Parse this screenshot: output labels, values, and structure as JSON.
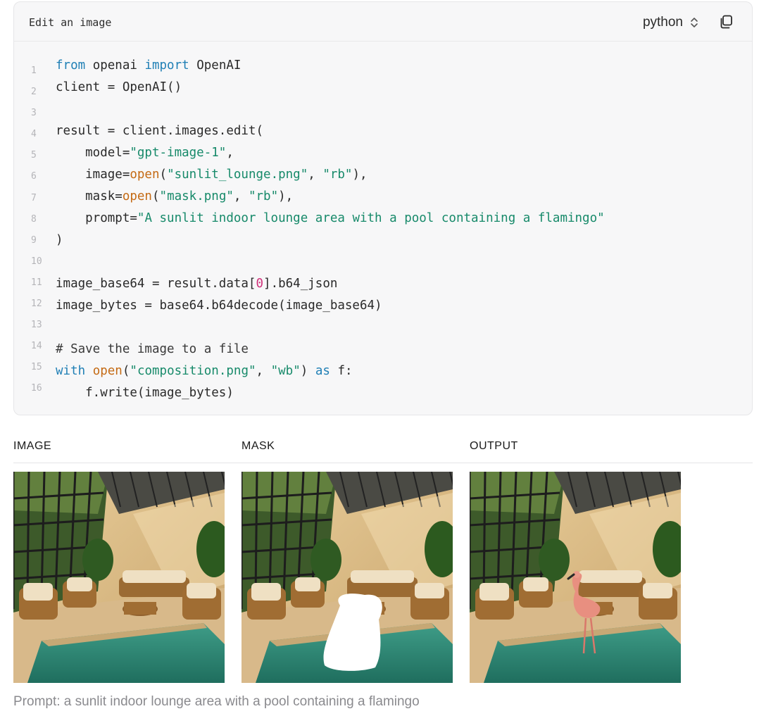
{
  "code_block": {
    "title": "Edit an image",
    "language": "python",
    "line_numbers": [
      "1",
      "2",
      "3",
      "4",
      "5",
      "6",
      "7",
      "8",
      "9",
      "10",
      "11",
      "12",
      "13",
      "14",
      "15",
      "16"
    ],
    "lines": [
      [
        {
          "t": "kw",
          "v": "from"
        },
        {
          "t": "p",
          "v": " openai "
        },
        {
          "t": "kw",
          "v": "import"
        },
        {
          "t": "p",
          "v": " OpenAI"
        }
      ],
      [
        {
          "t": "p",
          "v": "client = OpenAI()"
        }
      ],
      [],
      [
        {
          "t": "p",
          "v": "result = client.images.edit("
        }
      ],
      [
        {
          "t": "p",
          "v": "    model="
        },
        {
          "t": "str",
          "v": "\"gpt-image-1\""
        },
        {
          "t": "p",
          "v": ","
        }
      ],
      [
        {
          "t": "p",
          "v": "    image="
        },
        {
          "t": "fn",
          "v": "open"
        },
        {
          "t": "p",
          "v": "("
        },
        {
          "t": "str",
          "v": "\"sunlit_lounge.png\""
        },
        {
          "t": "p",
          "v": ", "
        },
        {
          "t": "str",
          "v": "\"rb\""
        },
        {
          "t": "p",
          "v": "),"
        }
      ],
      [
        {
          "t": "p",
          "v": "    mask="
        },
        {
          "t": "fn",
          "v": "open"
        },
        {
          "t": "p",
          "v": "("
        },
        {
          "t": "str",
          "v": "\"mask.png\""
        },
        {
          "t": "p",
          "v": ", "
        },
        {
          "t": "str",
          "v": "\"rb\""
        },
        {
          "t": "p",
          "v": "),"
        }
      ],
      [
        {
          "t": "p",
          "v": "    prompt="
        },
        {
          "t": "str",
          "v": "\"A sunlit indoor lounge area with a pool containing a flamingo\""
        }
      ],
      [
        {
          "t": "p",
          "v": ")"
        }
      ],
      [],
      [
        {
          "t": "p",
          "v": "image_base64 = result.data["
        },
        {
          "t": "num",
          "v": "0"
        },
        {
          "t": "p",
          "v": "].b64_json"
        }
      ],
      [
        {
          "t": "p",
          "v": "image_bytes = base64.b64decode(image_base64)"
        }
      ],
      [],
      [
        {
          "t": "cm",
          "v": "# Save the image to a file"
        }
      ],
      [
        {
          "t": "kw",
          "v": "with"
        },
        {
          "t": "p",
          "v": " "
        },
        {
          "t": "fn",
          "v": "open"
        },
        {
          "t": "p",
          "v": "("
        },
        {
          "t": "str",
          "v": "\"composition.png\""
        },
        {
          "t": "p",
          "v": ", "
        },
        {
          "t": "str",
          "v": "\"wb\""
        },
        {
          "t": "p",
          "v": ") "
        },
        {
          "t": "kw",
          "v": "as"
        },
        {
          "t": "p",
          "v": " f:"
        }
      ],
      [
        {
          "t": "p",
          "v": "    f.write(image_bytes)"
        }
      ]
    ],
    "icons": {
      "language": "chevron-up-down-icon",
      "copy": "copy-icon"
    }
  },
  "gallery": {
    "columns": [
      {
        "label": "IMAGE",
        "variant": "original"
      },
      {
        "label": "MASK",
        "variant": "mask"
      },
      {
        "label": "OUTPUT",
        "variant": "output"
      }
    ],
    "caption": "Prompt: a sunlit indoor lounge area with a pool containing a flamingo"
  },
  "colors": {
    "keyword": "#1f7fb5",
    "string": "#178a6a",
    "builtin": "#c46a14",
    "number": "#d0317a",
    "code_bg": "#f7f7f8",
    "caption": "#8a8a8e"
  }
}
